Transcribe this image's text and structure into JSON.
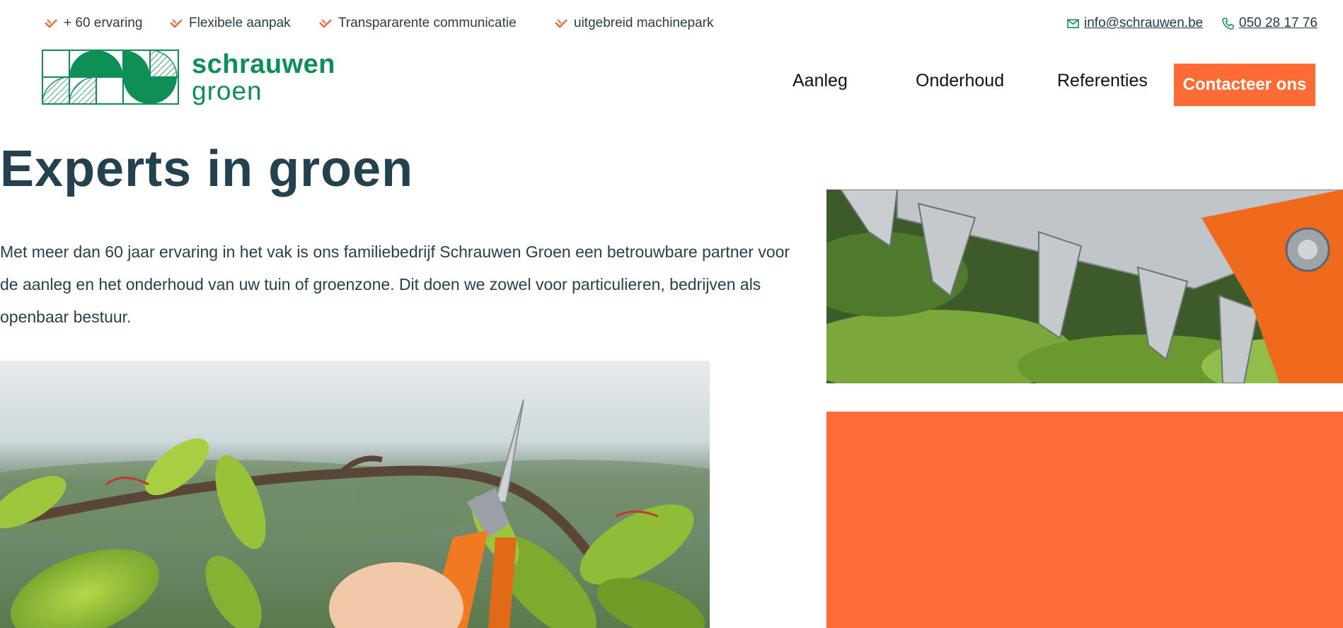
{
  "topbar": {
    "usps": [
      {
        "label": "+ 60 ervaring"
      },
      {
        "label": "Flexibele aanpak"
      },
      {
        "label": "Transpararente communicatie"
      },
      {
        "label": "uitgebreid machinepark"
      }
    ],
    "email": "info@schrauwen.be",
    "phone": "050 28 17 76"
  },
  "logo": {
    "word1": "schrauwen",
    "word2": "groen"
  },
  "nav": {
    "items": [
      "Aanleg",
      "Onderhoud",
      "Referenties"
    ],
    "cta": "Contacteer ons"
  },
  "hero": {
    "title": "Experts in groen",
    "intro": "Met meer dan 60 jaar ervaring in het vak is ons familiebedrijf Schrauwen Groen een betrouwbare partner voor de aanleg en het onderhoud van uw tuin of groenzone. Dit doen we zowel voor particulieren, bedrijven als openbaar bestuur."
  },
  "colors": {
    "brand_green": "#0e8f56",
    "accent_orange": "#ff6b35",
    "text_dark": "#24414f"
  },
  "icons": {
    "usp": "check-icon",
    "email": "mail-icon",
    "phone": "phone-icon"
  }
}
